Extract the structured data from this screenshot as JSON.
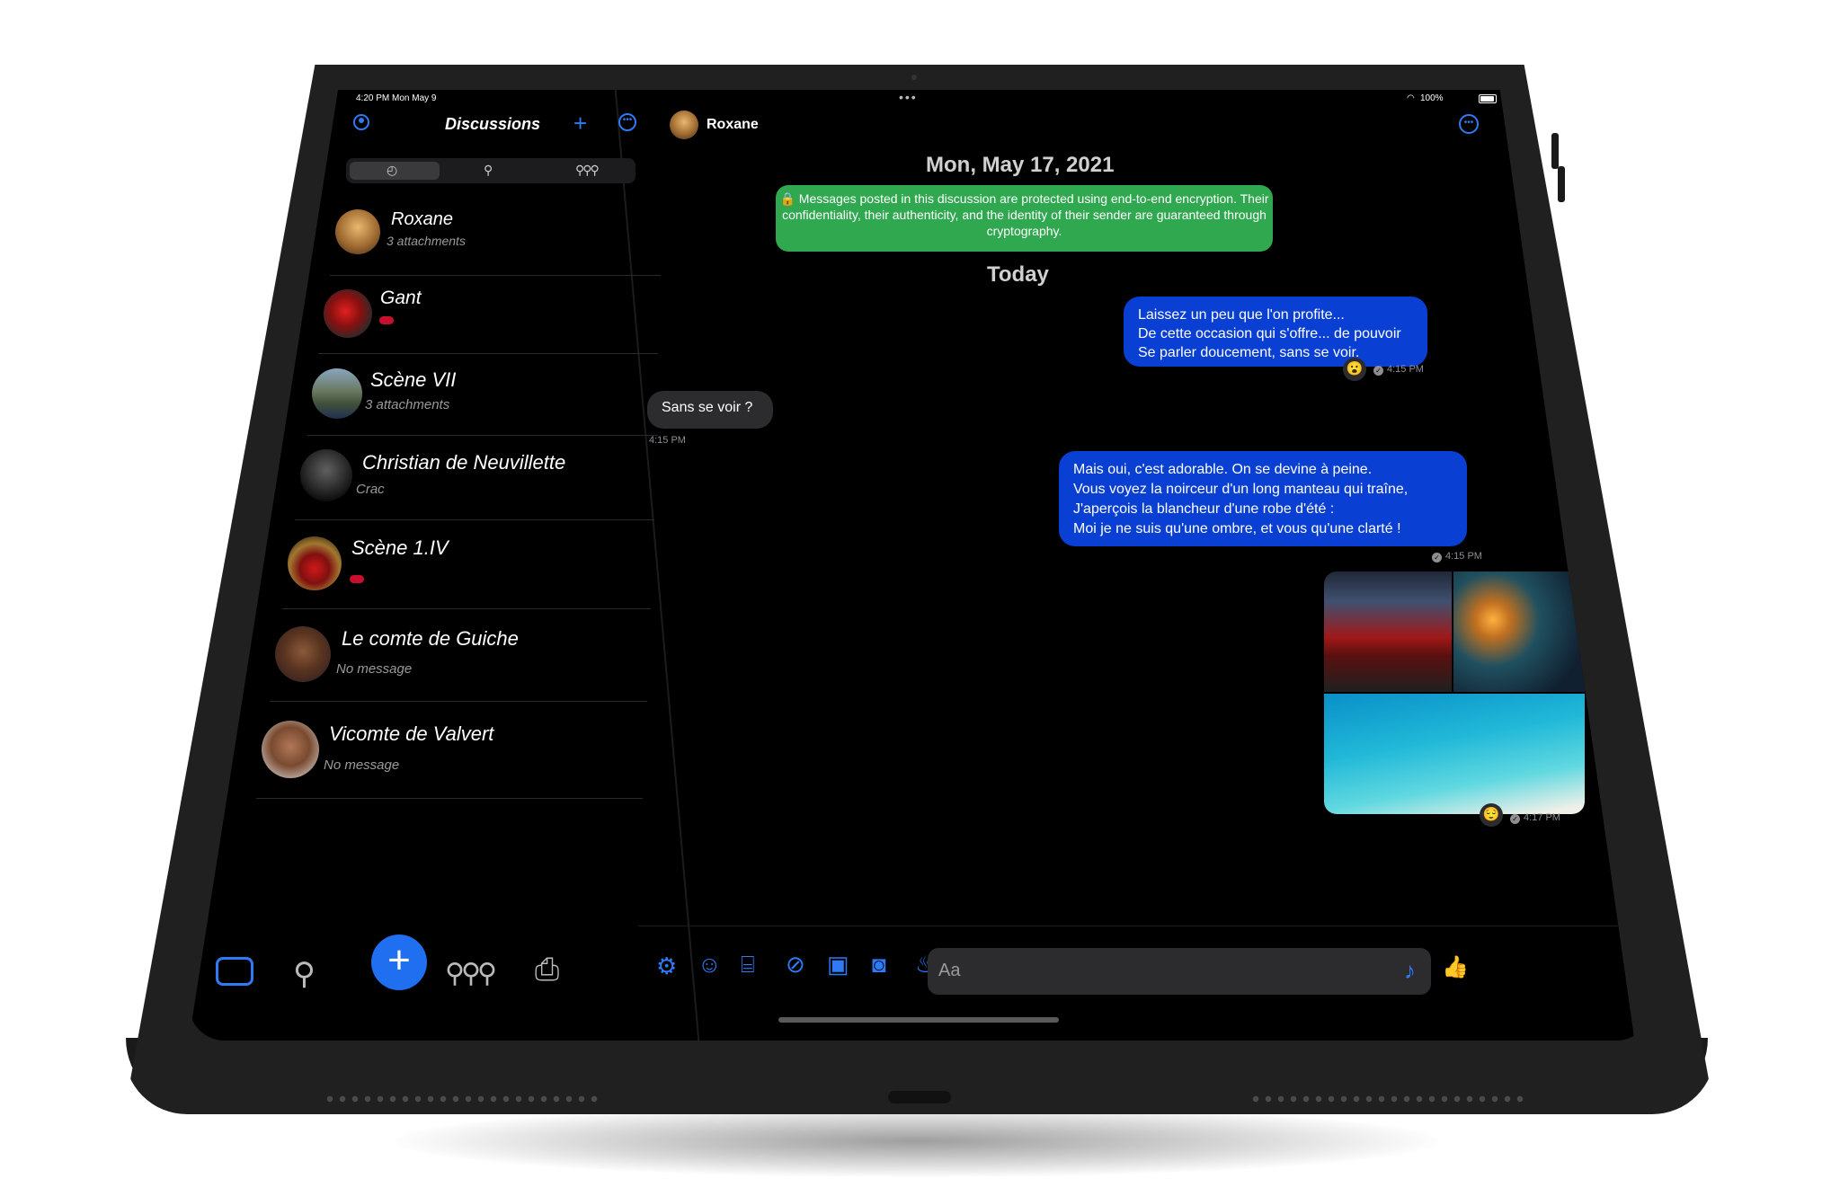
{
  "status_bar": {
    "time": "4:20 PM  Mon May 9",
    "battery": "100%"
  },
  "sidebar": {
    "title": "Discussions",
    "discussions": [
      {
        "name": "Roxane",
        "subtitle": "3 attachments"
      },
      {
        "name": "Gant",
        "subtitle": ""
      },
      {
        "name": "Scène VII",
        "subtitle": "3 attachments"
      },
      {
        "name": "Christian de Neuvillette",
        "subtitle": "Crac"
      },
      {
        "name": "Scène 1.IV",
        "subtitle": ""
      },
      {
        "name": "Le comte de Guiche",
        "subtitle": "No message"
      },
      {
        "name": "Vicomte de Valvert",
        "subtitle": "No message"
      }
    ]
  },
  "chat": {
    "contact_name": "Roxane",
    "date_header": "Mon, May 17, 2021",
    "encryption_notice_line1": "🔒 Messages posted in this discussion are protected using end-to-end encryption. Their",
    "encryption_notice_line2": "confidentiality, their authenticity, and the identity of their sender are guaranteed through",
    "encryption_notice_line3": "cryptography.",
    "today_label": "Today",
    "messages": [
      {
        "lines": [
          "Laissez un peu que l'on profite...",
          "De cette occasion qui s'offre... de pouvoir",
          "Se parler doucement, sans se voir."
        ],
        "time": "4:15 PM",
        "reaction": "😮"
      },
      {
        "text": "Sans se voir ?",
        "time": "4:15 PM"
      },
      {
        "lines": [
          "Mais oui, c'est adorable. On se devine à peine.",
          "Vous voyez la noirceur d'un long manteau qui traîne,",
          "J'aperçois la blancheur d'une robe d'été :",
          "Moi je ne suis qu'une ombre, et vous qu'une clarté !"
        ],
        "time": "4:15 PM"
      },
      {
        "time": "4:17 PM",
        "reaction": "😌"
      }
    ],
    "composer_placeholder": "Aa",
    "like_emoji": "👍"
  },
  "colors": {
    "accent": "#2f7af5",
    "outgoing_bubble": "#0a3fd3",
    "encryption_green": "#2fa84f",
    "incoming_bubble": "#2c2c2e"
  }
}
